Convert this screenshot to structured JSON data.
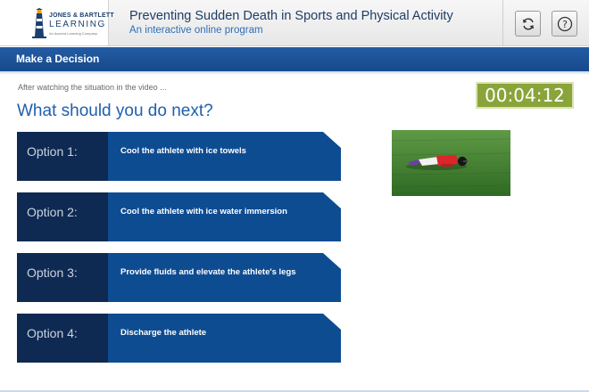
{
  "header": {
    "logo": {
      "line1": "JONES & BARTLETT",
      "line2": "LEARNING",
      "line3": "An Ascend Learning Company"
    },
    "title": "Preventing Sudden Death in Sports and Physical Activity",
    "subtitle": "An interactive online program",
    "buttons": [
      {
        "icon": "refresh-icon"
      },
      {
        "icon": "help-icon",
        "glyph": "?"
      }
    ]
  },
  "section": {
    "title": "Make a Decision"
  },
  "main": {
    "instruction": "After watching the situation in the video ...",
    "question": "What should you do next?",
    "timer": "00:04:12",
    "options": [
      {
        "number_label": "Option 1:",
        "text": "Cool the athlete with ice towels"
      },
      {
        "number_label": "Option 2:",
        "text": "Cool the athlete with ice water immersion"
      },
      {
        "number_label": "Option 3:",
        "text": "Provide fluids and elevate the athlete's legs"
      },
      {
        "number_label": "Option 4:",
        "text": "Discharge the athlete"
      }
    ]
  },
  "colors": {
    "brand_blue": "#1f5fae",
    "bar_blue": "#174a8c",
    "option_dark": "#0f2a52",
    "option_main": "#0e4c92",
    "timer_green": "#8aa43a"
  }
}
